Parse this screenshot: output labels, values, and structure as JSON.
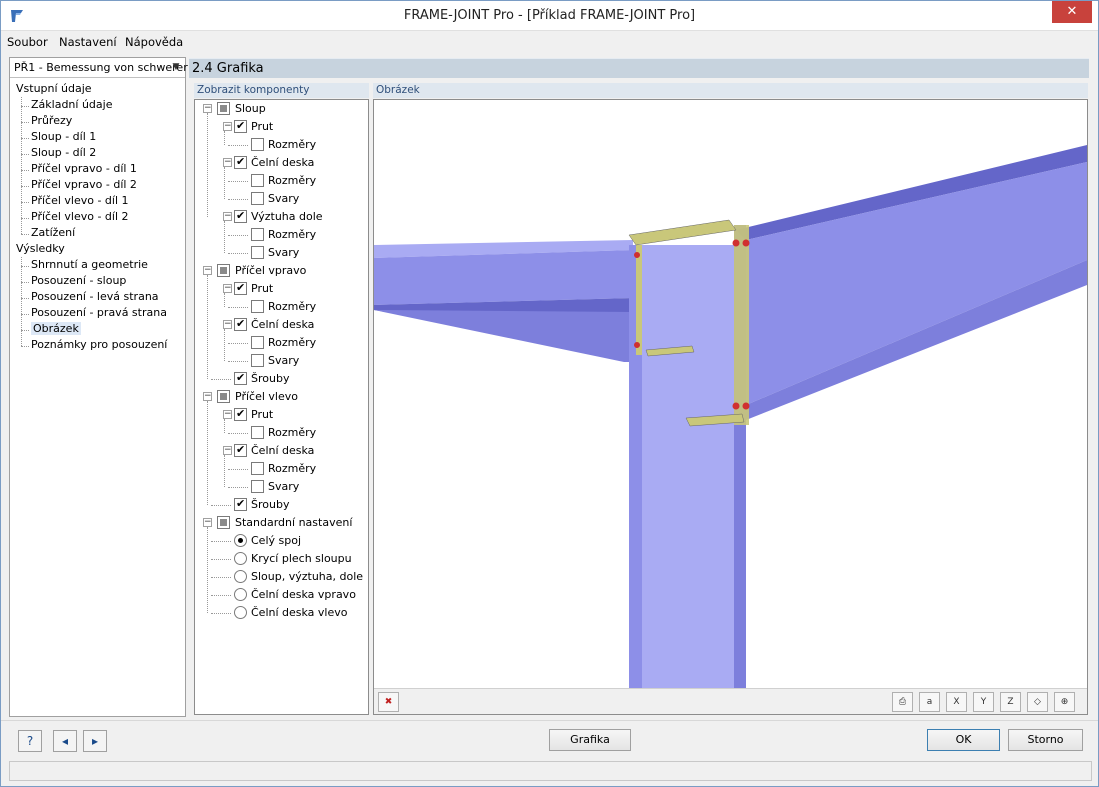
{
  "window": {
    "title": "FRAME-JOINT Pro - [Příklad FRAME-JOINT Pro]",
    "close_symbol": "✕"
  },
  "menu": [
    "Soubor",
    "Nastavení",
    "Nápověda"
  ],
  "navigation": {
    "combo_value": "PŘ1 - Bemessung von schwerer",
    "groups": [
      {
        "label": "Vstupní údaje",
        "items": [
          "Základní údaje",
          "Průřezy",
          "Sloup - díl 1",
          "Sloup - díl 2",
          "Příčel vpravo - díl 1",
          "Příčel vpravo - díl 2",
          "Příčel vlevo - díl 1",
          "Příčel vlevo - díl 2",
          "Zatížení"
        ]
      },
      {
        "label": "Výsledky",
        "items": [
          "Shrnnutí a geometrie",
          "Posouzení - sloup",
          "Posouzení - levá strana",
          "Posouzení - pravá strana",
          "Obrázek",
          "Poznámky pro posouzení"
        ]
      }
    ],
    "selected": "Obrázek"
  },
  "section_title": "2.4 Grafika",
  "components": {
    "header": "Zobrazit komponenty",
    "tree": [
      {
        "label": "Sloup",
        "level": 0,
        "type": "group"
      },
      {
        "label": "Prut",
        "level": 1,
        "type": "check",
        "checked": true
      },
      {
        "label": "Rozměry",
        "level": 2,
        "type": "check",
        "checked": false
      },
      {
        "label": "Čelní deska",
        "level": 1,
        "type": "check",
        "checked": true
      },
      {
        "label": "Rozměry",
        "level": 2,
        "type": "check",
        "checked": false
      },
      {
        "label": "Svary",
        "level": 2,
        "type": "check",
        "checked": false
      },
      {
        "label": "Výztuha dole",
        "level": 1,
        "type": "check",
        "checked": true
      },
      {
        "label": "Rozměry",
        "level": 2,
        "type": "check",
        "checked": false
      },
      {
        "label": "Svary",
        "level": 2,
        "type": "check",
        "checked": false
      },
      {
        "label": "Příčel vpravo",
        "level": 0,
        "type": "group"
      },
      {
        "label": "Prut",
        "level": 1,
        "type": "check",
        "checked": true
      },
      {
        "label": "Rozměry",
        "level": 2,
        "type": "check",
        "checked": false
      },
      {
        "label": "Čelní deska",
        "level": 1,
        "type": "check",
        "checked": true
      },
      {
        "label": "Rozměry",
        "level": 2,
        "type": "check",
        "checked": false
      },
      {
        "label": "Svary",
        "level": 2,
        "type": "check",
        "checked": false
      },
      {
        "label": "Šrouby",
        "level": 1,
        "type": "check",
        "checked": true
      },
      {
        "label": "Příčel vlevo",
        "level": 0,
        "type": "group"
      },
      {
        "label": "Prut",
        "level": 1,
        "type": "check",
        "checked": true
      },
      {
        "label": "Rozměry",
        "level": 2,
        "type": "check",
        "checked": false
      },
      {
        "label": "Čelní deska",
        "level": 1,
        "type": "check",
        "checked": true
      },
      {
        "label": "Rozměry",
        "level": 2,
        "type": "check",
        "checked": false
      },
      {
        "label": "Svary",
        "level": 2,
        "type": "check",
        "checked": false
      },
      {
        "label": "Šrouby",
        "level": 1,
        "type": "check",
        "checked": true
      },
      {
        "label": "Standardní nastavení",
        "level": 0,
        "type": "group"
      },
      {
        "label": "Celý spoj",
        "level": 1,
        "type": "radio",
        "checked": true
      },
      {
        "label": "Krycí plech sloupu",
        "level": 1,
        "type": "radio",
        "checked": false
      },
      {
        "label": "Sloup, výztuha, dole",
        "level": 1,
        "type": "radio",
        "checked": false
      },
      {
        "label": "Čelní deska vpravo",
        "level": 1,
        "type": "radio",
        "checked": false
      },
      {
        "label": "Čelní deska vlevo",
        "level": 1,
        "type": "radio",
        "checked": false
      }
    ]
  },
  "image_panel": {
    "header": "Obrázek",
    "colors": {
      "steel": "#8d8fe8",
      "steel_dark": "#6466c9",
      "steel_light": "#a9abf3",
      "plate": "#c9c77a",
      "bolt": "#d03030"
    },
    "toolbar_left": [
      {
        "icon": "reset-view-icon",
        "glyph": "✖"
      }
    ],
    "toolbar_right": [
      {
        "icon": "print-icon",
        "glyph": "⎙"
      },
      {
        "icon": "dimension-icon",
        "glyph": "a"
      },
      {
        "icon": "view-x-icon",
        "glyph": "X"
      },
      {
        "icon": "view-y-icon",
        "glyph": "Y"
      },
      {
        "icon": "view-z-icon",
        "glyph": "Z"
      },
      {
        "icon": "isometric-view-icon",
        "glyph": "◇"
      },
      {
        "icon": "zoom-icon",
        "glyph": "⊕"
      }
    ]
  },
  "bottom": {
    "icons": [
      {
        "icon": "help-icon",
        "glyph": "?"
      },
      {
        "icon": "previous-icon",
        "glyph": "◂"
      },
      {
        "icon": "next-icon",
        "glyph": "▸"
      }
    ],
    "grafika_label": "Grafika",
    "ok_label": "OK",
    "cancel_label": "Storno"
  }
}
